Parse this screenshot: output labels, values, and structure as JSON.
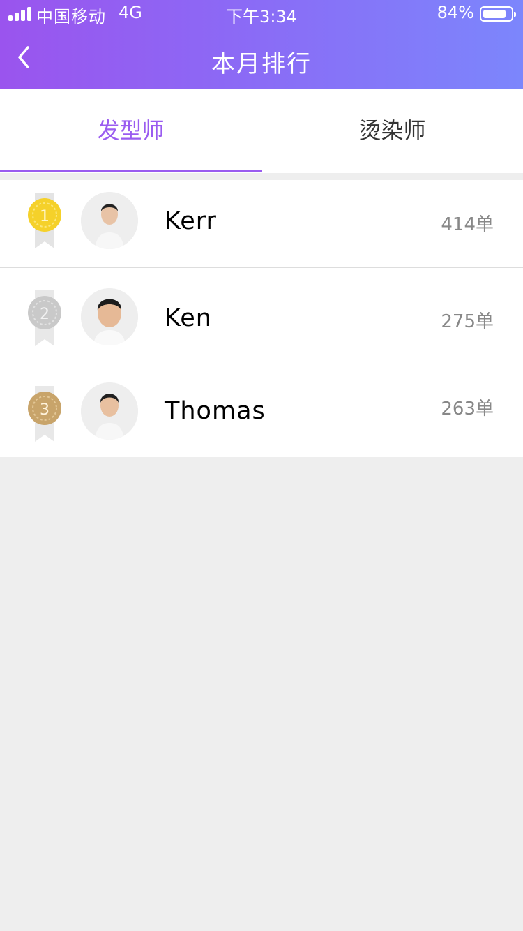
{
  "status_bar": {
    "carrier": "中国移动",
    "network": "4G",
    "time": "下午3:34",
    "battery_percent": "84%",
    "battery_level": 0.84
  },
  "nav": {
    "title": "本月排行",
    "back_icon": "chevron-left-icon"
  },
  "tabs": [
    {
      "label": "发型师",
      "active": true
    },
    {
      "label": "烫染师",
      "active": false
    }
  ],
  "ranking": [
    {
      "rank": "1",
      "medal": "gold-medal-icon",
      "medal_color": "#f5d12a",
      "name": "Kerr",
      "orders": "414单"
    },
    {
      "rank": "2",
      "medal": "silver-medal-icon",
      "medal_color": "#c9c9c9",
      "name": "Ken",
      "orders": "275单"
    },
    {
      "rank": "3",
      "medal": "bronze-medal-icon",
      "medal_color": "#c8a46a",
      "name": "Thomas",
      "orders": "263单"
    }
  ],
  "colors": {
    "header_gradient_start": "#9a54ee",
    "header_gradient_end": "#7c86fc",
    "accent": "#9a5cf0",
    "background": "#eeeeee"
  }
}
